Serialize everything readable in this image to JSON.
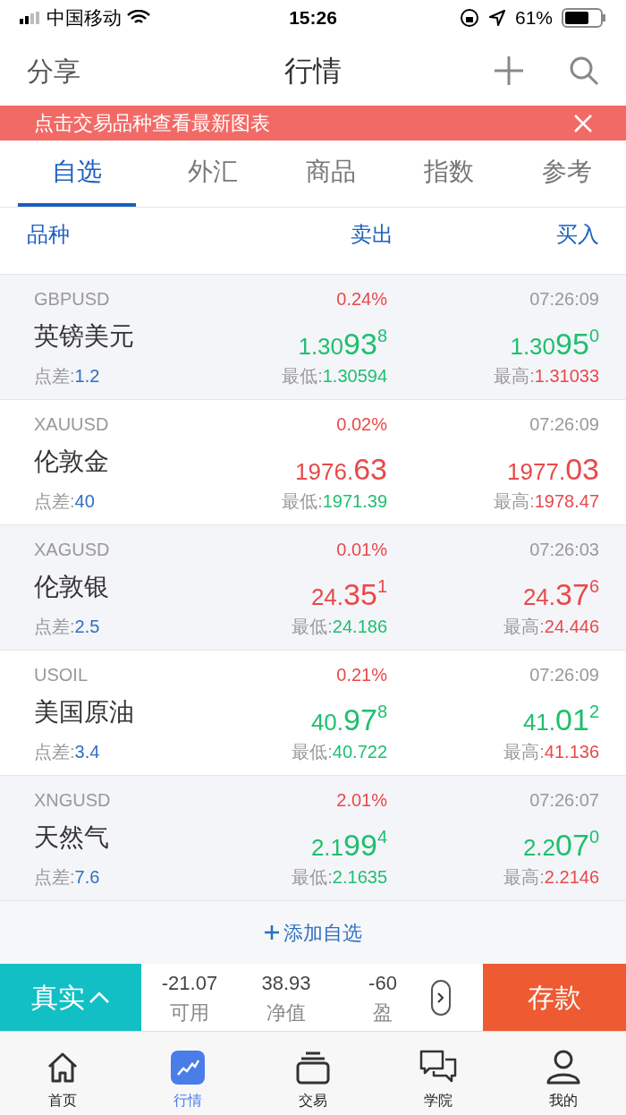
{
  "status_bar": {
    "carrier": "中国移动",
    "time": "15:26",
    "battery": "61%"
  },
  "nav": {
    "left": "分享",
    "title": "行情"
  },
  "banner": {
    "text": "点击交易品种查看最新图表"
  },
  "tabs": [
    {
      "label": "自选",
      "selected": true
    },
    {
      "label": "外汇",
      "selected": false
    },
    {
      "label": "商品",
      "selected": false
    },
    {
      "label": "指数",
      "selected": false
    },
    {
      "label": "参考",
      "selected": false
    }
  ],
  "columns": [
    "品种",
    "卖出",
    "买入"
  ],
  "rows": [
    {
      "symbol": "GBPUSD",
      "change": "0.24%",
      "time": "07:26:09",
      "name": "英镑美元",
      "color": "#1fbf6e",
      "bid": {
        "head": "1.30",
        "big": "93",
        "sup": "8"
      },
      "ask": {
        "head": "1.30",
        "big": "95",
        "sup": "0"
      },
      "spread_label": "点差:",
      "spread": "1.2",
      "low_label": "最低:",
      "low": "1.30594",
      "high_label": "最高:",
      "high": "1.31033"
    },
    {
      "symbol": "XAUUSD",
      "change": "0.02%",
      "time": "07:26:09",
      "name": "伦敦金",
      "color": "#e8494a",
      "bid": {
        "head": "1976.",
        "big": "63"
      },
      "ask": {
        "head": "1977.",
        "big": "03"
      },
      "spread_label": "点差:",
      "spread": "40",
      "low_label": "最低:",
      "low": "1971.39",
      "high_label": "最高:",
      "high": "1978.47"
    },
    {
      "symbol": "XAGUSD",
      "change": "0.01%",
      "time": "07:26:03",
      "name": "伦敦银",
      "color": "#e8494a",
      "bid": {
        "head": "24.",
        "big": "35",
        "sup": "1"
      },
      "ask": {
        "head": "24.",
        "big": "37",
        "sup": "6"
      },
      "spread_label": "点差:",
      "spread": "2.5",
      "low_label": "最低:",
      "low": "24.186",
      "high_label": "最高:",
      "high": "24.446"
    },
    {
      "symbol": "USOIL",
      "change": "0.21%",
      "time": "07:26:09",
      "name": "美国原油",
      "color": "#1fbf6e",
      "bid": {
        "head": "40.",
        "big": "97",
        "sup": "8"
      },
      "ask": {
        "head": "41.",
        "big": "01",
        "sup": "2"
      },
      "spread_label": "点差:",
      "spread": "3.4",
      "low_label": "最低:",
      "low": "40.722",
      "high_label": "最高:",
      "high": "41.136"
    },
    {
      "symbol": "XNGUSD",
      "change": "2.01%",
      "time": "07:26:07",
      "name": "天然气",
      "color": "#1fbf6e",
      "bid": {
        "head": "2.1",
        "big": "99",
        "sup": "4"
      },
      "ask": {
        "head": "2.2",
        "big": "07",
        "sup": "0"
      },
      "spread_label": "点差:",
      "spread": "7.6",
      "low_label": "最低:",
      "low": "2.1635",
      "high_label": "最高:",
      "high": "2.2146"
    }
  ],
  "add_button": "添加自选",
  "account": {
    "mode": "真实",
    "stats": [
      {
        "value": "-21.07",
        "label": "可用"
      },
      {
        "value": "38.93",
        "label": "净值"
      },
      {
        "value": "-60",
        "label": "盈"
      }
    ],
    "deposit": "存款"
  },
  "bottom_tabs": [
    {
      "label": "首页",
      "kind": "home",
      "selected": false
    },
    {
      "label": "行情",
      "kind": "chart",
      "selected": true
    },
    {
      "label": "交易",
      "kind": "stack",
      "selected": false
    },
    {
      "label": "学院",
      "kind": "chat",
      "selected": false
    },
    {
      "label": "我的",
      "kind": "user",
      "selected": false
    }
  ]
}
